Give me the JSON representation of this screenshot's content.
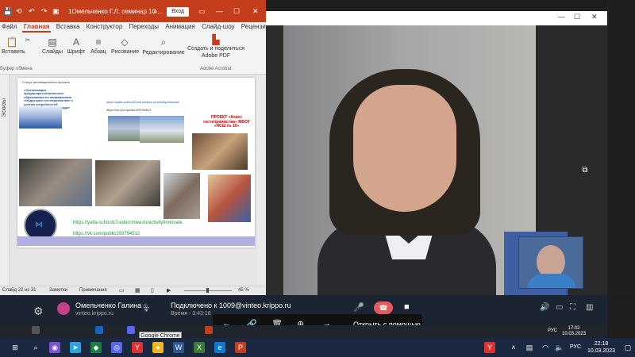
{
  "powerpoint": {
    "window_title": "1Омельченко Г.Л. семинар 10....",
    "login_label": "Вход",
    "tabs": [
      "Файл",
      "Главная",
      "Вставка",
      "Конструктор",
      "Переходы",
      "Анимация",
      "Слайд-шоу",
      "Рецензирова"
    ],
    "active_tab": "Главная",
    "ribbon": {
      "paste": "Вставить",
      "clipboard": "Буфер обмена",
      "slides": "Слайды",
      "font": "Шрифт",
      "paragraph": "Абзац",
      "drawing": "Рисование",
      "editing": "Редактирование",
      "adobe_create": "Создать и поделиться Adobe PDF",
      "adobe_group": "Adobe Acrobat"
    },
    "sidebar_label": "Эскизы",
    "slide": {
      "red_title": "ПРОЕКТ «Класс гостеприимства» МБОУ «ЯСШ № 10»",
      "link1": "https://yalta-school10.educrimea.ru/activity/innovate",
      "link2": "https://vk.com/public193794512",
      "tiny_link1": "https://yalta-school10.educrimea.ru/activity/innovate",
      "tiny_link2": "https://vk.com/public193794512",
      "tiny_text1": "Статус инновационного проекта:",
      "tiny_text2": "«Организация предпрофессионального образования по направлению «Индустрия гостеприимства» с учетом потребностей регионального рынка труда»"
    },
    "status": {
      "slide_counter": "Слайд 22 из 31",
      "notes": "Заметки",
      "comments": "Примечания",
      "zoom": "45 %"
    }
  },
  "call": {
    "caller_name": "Омельченко Галина ...",
    "caller_address": "vinteo.krippo.ru",
    "connected_text": "Подключено к 1009@vinteo.krippo.ru",
    "time_text": "Время - 3:43:18",
    "open_with": "Открыть с помощью"
  },
  "taskbar": {
    "tooltip": "Google Chrome",
    "language": "РУС",
    "time": "22:18",
    "date": "10.03.2023"
  },
  "inner_taskbar": {
    "language": "РУС",
    "time": "17:02",
    "date": "10.03.2023"
  },
  "colors": {
    "ppt_accent": "#c43e1c",
    "link_green": "#1a9c3a",
    "hangup_red": "#e45b5b"
  }
}
